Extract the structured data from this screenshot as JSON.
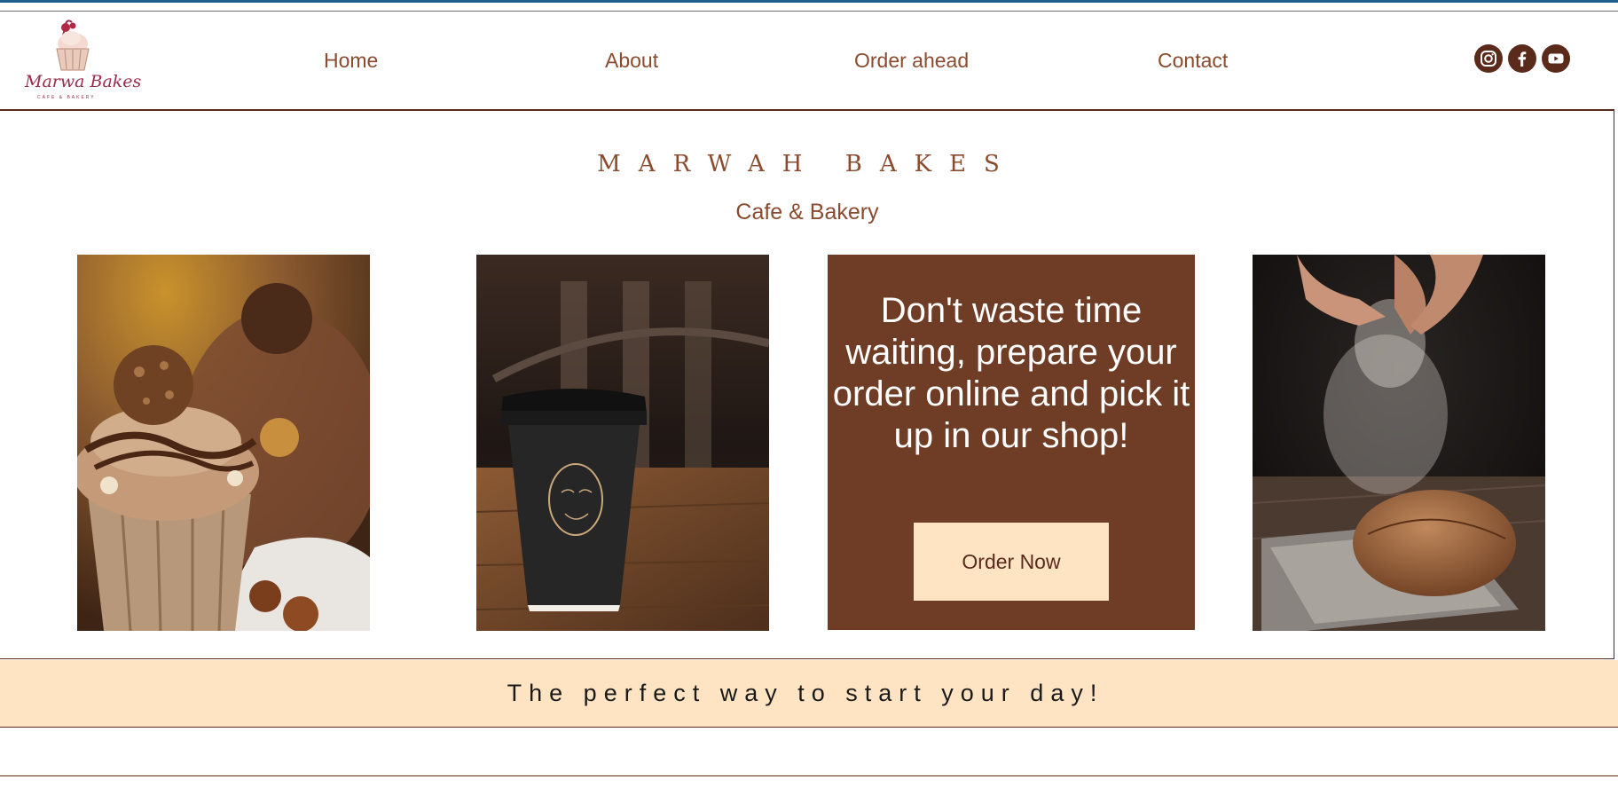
{
  "logo": {
    "name": "Marwa Bakes",
    "tagline": "CAFE & BAKERY"
  },
  "nav": {
    "home": "Home",
    "about": "About",
    "order_ahead": "Order ahead",
    "contact": "Contact"
  },
  "social": {
    "icons": [
      "instagram-icon",
      "facebook-icon",
      "youtube-icon"
    ]
  },
  "hero": {
    "title": "MARWAH BAKES",
    "subtitle": "Cafe & Bakery"
  },
  "promo": {
    "text": "Don't waste time waiting, prepare your order online and pick it up in our shop!",
    "button_label": "Order Now"
  },
  "banner": {
    "text": "The perfect way to start your day!"
  },
  "colors": {
    "accent": "#8a4b2e",
    "promo_background": "#6f3c25",
    "cream": "#ffe4c4",
    "dark_brown": "#5a2a1a",
    "top_bar": "#1f5f8b"
  }
}
